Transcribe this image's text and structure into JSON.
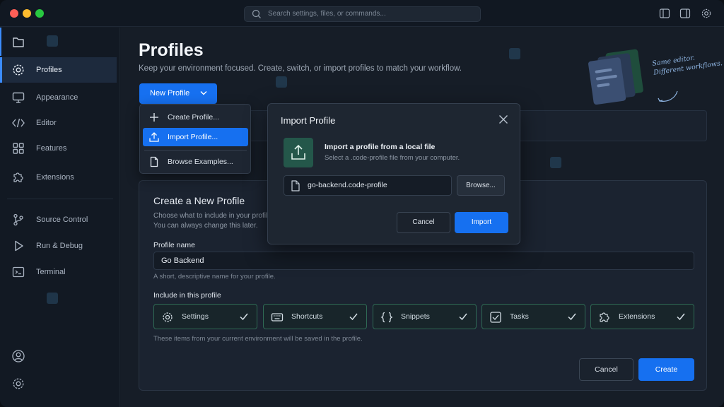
{
  "titlebar": {
    "search_placeholder": "Search settings, files, or commands..."
  },
  "sidebar": {
    "items": [
      {
        "label": "",
        "icon": "files-icon"
      },
      {
        "label": "Profiles",
        "icon": "gear-icon"
      },
      {
        "label": "Appearance",
        "icon": "monitor-icon"
      },
      {
        "label": "Editor",
        "icon": "code-icon"
      },
      {
        "label": "Features",
        "icon": "grid-icon"
      },
      {
        "label": "Extensions",
        "icon": "puzzle-icon"
      },
      {
        "label": "Source Control",
        "icon": "branch-icon"
      },
      {
        "label": "Run & Debug",
        "icon": "play-icon"
      },
      {
        "label": "Terminal",
        "icon": "terminal-icon"
      }
    ],
    "active_index": 1
  },
  "main": {
    "title": "Profiles",
    "subtitle": "Keep your environment focused. Create, switch, or import profiles to match your workflow.",
    "new_profile_label": "New Profile",
    "illustration_text_1": "Same editor.",
    "illustration_text_2": "Different workflows."
  },
  "dropdown": {
    "items": [
      {
        "label": "Create Profile...",
        "icon": "plus-icon"
      },
      {
        "label": "Import Profile...",
        "icon": "upload-icon",
        "selected": true
      },
      {
        "label": "Browse Examples...",
        "icon": "document-icon"
      }
    ]
  },
  "modal": {
    "title": "Import Profile",
    "heading": "Import a profile from a local file",
    "subtext": "Select a .code-profile file from your computer.",
    "file_value": "go-backend.code-profile",
    "browse_label": "Browse...",
    "cancel_label": "Cancel",
    "import_label": "Import"
  },
  "create_card": {
    "title": "Create a New Profile",
    "sub1": "Choose what to include in your profile",
    "sub2": "You can always change this later.",
    "name_label": "Profile name",
    "name_value": "Go Backend",
    "name_help": "A short, descriptive name for your profile.",
    "include_label": "Include in this profile",
    "chips": [
      {
        "label": "Settings",
        "icon": "gear-icon",
        "checked": true
      },
      {
        "label": "Shortcuts",
        "icon": "keyboard-icon",
        "checked": true
      },
      {
        "label": "Snippets",
        "icon": "braces-icon",
        "checked": true
      },
      {
        "label": "Tasks",
        "icon": "checkbox-icon",
        "checked": true
      },
      {
        "label": "Extensions",
        "icon": "puzzle-icon",
        "checked": true
      }
    ],
    "footer_text": "These items from your current environment will be saved in the profile.",
    "cancel_label": "Cancel",
    "create_label": "Create"
  },
  "colors": {
    "accent": "#1670f0",
    "chip_border": "#2f6a55",
    "upload_tile": "#24574a"
  }
}
